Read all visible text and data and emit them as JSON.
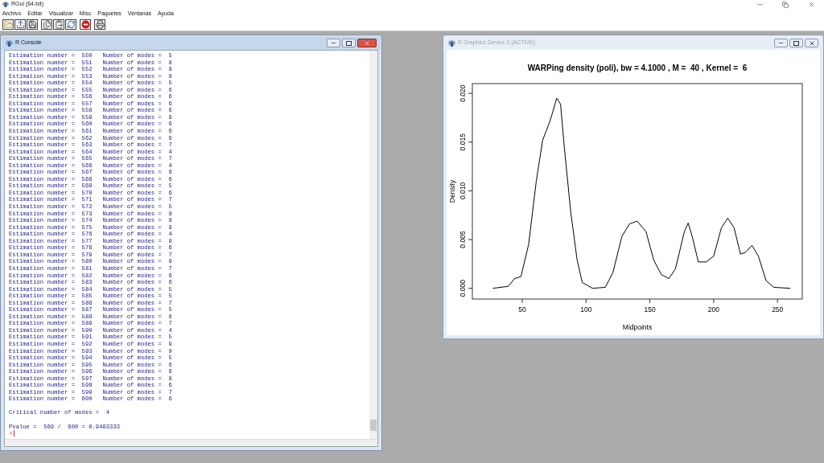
{
  "app": {
    "title": "RGui (64-bit)",
    "menu": [
      "Archivo",
      "Editar",
      "Visualizar",
      "Misc",
      "Paquetes",
      "Ventanas",
      "Ayuda"
    ],
    "toolbar": [
      {
        "kind": "open"
      },
      {
        "kind": "load"
      },
      {
        "kind": "save"
      },
      {
        "kind": "copy"
      },
      {
        "kind": "paste"
      },
      {
        "kind": "refresh"
      },
      {
        "kind": "stop"
      },
      {
        "kind": "print"
      }
    ]
  },
  "console": {
    "title": "R Console",
    "active": true,
    "lines": [
      "Estimation number =  550   Number of modes =  5",
      "Estimation number =  551   Number of modes =  8",
      "Estimation number =  552   Number of modes =  8",
      "Estimation number =  553   Number of modes =  9",
      "Estimation number =  554   Number of modes =  5",
      "Estimation number =  555   Number of modes =  6",
      "Estimation number =  556   Number of modes =  6",
      "Estimation number =  557   Number of modes =  6",
      "Estimation number =  558   Number of modes =  6",
      "Estimation number =  559   Number of modes =  9",
      "Estimation number =  560   Number of modes =  6",
      "Estimation number =  561   Number of modes =  6",
      "Estimation number =  562   Number of modes =  6",
      "Estimation number =  563   Number of modes =  7",
      "Estimation number =  564   Number of modes =  4",
      "Estimation number =  565   Number of modes =  7",
      "Estimation number =  566   Number of modes =  4",
      "Estimation number =  567   Number of modes =  6",
      "Estimation number =  568   Number of modes =  6",
      "Estimation number =  569   Number of modes =  5",
      "Estimation number =  570   Number of modes =  6",
      "Estimation number =  571   Number of modes =  7",
      "Estimation number =  572   Number of modes =  5",
      "Estimation number =  573   Number of modes =  8",
      "Estimation number =  574   Number of modes =  8",
      "Estimation number =  575   Number of modes =  9",
      "Estimation number =  576   Number of modes =  4",
      "Estimation number =  577   Number of modes =  8",
      "Estimation number =  578   Number of modes =  6",
      "Estimation number =  579   Number of modes =  7",
      "Estimation number =  580   Number of modes =  9",
      "Estimation number =  581   Number of modes =  7",
      "Estimation number =  582   Number of modes =  6",
      "Estimation number =  583   Number of modes =  6",
      "Estimation number =  584   Number of modes =  5",
      "Estimation number =  585   Number of modes =  5",
      "Estimation number =  586   Number of modes =  7",
      "Estimation number =  587   Number of modes =  5",
      "Estimation number =  588   Number of modes =  6",
      "Estimation number =  589   Number of modes =  7",
      "Estimation number =  590   Number of modes =  4",
      "Estimation number =  591   Number of modes =  5",
      "Estimation number =  592   Number of modes =  9",
      "Estimation number =  593   Number of modes =  9",
      "Estimation number =  594   Number of modes =  5",
      "Estimation number =  595   Number of modes =  6",
      "Estimation number =  596   Number of modes =  6",
      "Estimation number =  597   Number of modes =  8",
      "Estimation number =  598   Number of modes =  6",
      "Estimation number =  599   Number of modes =  7",
      "Estimation number =  600   Number of modes =  6"
    ],
    "summary": [
      "Critical number of modes =  4",
      "Pvalue =  569 /  600 = 0.9483333"
    ],
    "prompt": ">"
  },
  "graphics": {
    "title": "R Graphics Device 2 (ACTIVE)",
    "active": false,
    "chart_data": {
      "type": "line",
      "title": "WARPing density (poli), bw = 4.1000 , M =  40 , Kernel =  6",
      "xlabel": "Midpoints",
      "ylabel": "Density",
      "xlim": [
        10.9,
        269.4
      ],
      "ylim": [
        -0.0011,
        0.021
      ],
      "xticks": [
        50,
        100,
        150,
        200,
        250
      ],
      "yticks": [
        {
          "value": 0,
          "label": "0.000"
        },
        {
          "value": 0.005,
          "label": "0.005"
        },
        {
          "value": 0.01,
          "label": "0.010"
        },
        {
          "value": 0.015,
          "label": "0.015"
        },
        {
          "value": 0.02,
          "label": "0.020"
        }
      ],
      "x": [
        27,
        39,
        44,
        49,
        55,
        61,
        66,
        71,
        73,
        77,
        80,
        83,
        88,
        93,
        97,
        105,
        115,
        121,
        128,
        134,
        140,
        147,
        153,
        159,
        165,
        170,
        177,
        180,
        183,
        188,
        194,
        200,
        206,
        211,
        216,
        221,
        225,
        230,
        235,
        241,
        247,
        260
      ],
      "series": [
        {
          "color": "#000000",
          "values": [
            0,
            0.0002,
            0.001,
            0.0012,
            0.0045,
            0.011,
            0.0152,
            0.0169,
            0.0177,
            0.0195,
            0.0189,
            0.0144,
            0.0078,
            0.0029,
            0.0006,
            0,
            0.0001,
            0.0016,
            0.0053,
            0.0066,
            0.0069,
            0.0058,
            0.0029,
            0.0014,
            0.001,
            0.002,
            0.0058,
            0.0067,
            0.0054,
            0.0027,
            0.0027,
            0.0033,
            0.0062,
            0.0072,
            0.0062,
            0.0035,
            0.0037,
            0.0044,
            0.0033,
            0.0008,
            0.0001,
            0
          ]
        }
      ]
    }
  }
}
